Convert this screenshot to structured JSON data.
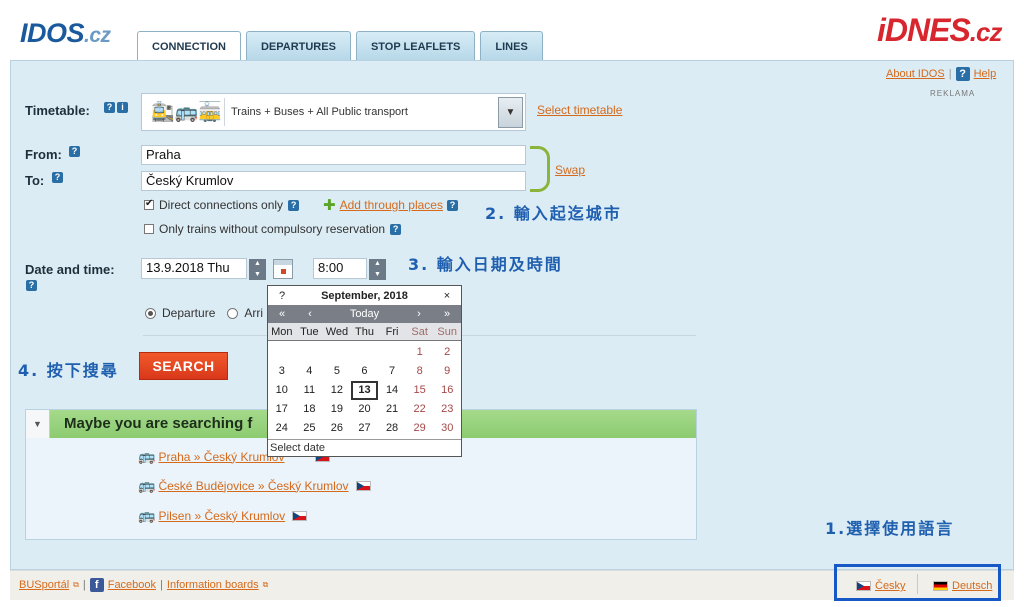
{
  "brand": {
    "idos_main": "IDOS",
    "idos_domain": ".cz",
    "idnes_main": "iDNES",
    "idnes_domain": ".cz"
  },
  "tabs": [
    {
      "label": "CONNECTION",
      "active": true
    },
    {
      "label": "DEPARTURES"
    },
    {
      "label": "STOP LEAFLETS"
    },
    {
      "label": "LINES"
    }
  ],
  "toplinks": {
    "about": "About IDOS",
    "help": "Help",
    "help_badge": "?"
  },
  "ad_label": "REKLAMA",
  "timetable": {
    "label": "Timetable:",
    "badge_q": "?",
    "badge_i": "i",
    "icons": "🚉🚌🚋",
    "value": "Trains + Buses + All Public transport",
    "select_link": "Select timetable",
    "dropdown_glyph": "▼"
  },
  "route": {
    "from_label": "From:",
    "to_label": "To:",
    "badge": "?",
    "from_value": "Praha",
    "to_value": "Český Krumlov",
    "swap_label": "Swap"
  },
  "options": {
    "direct_label": "Direct connections only",
    "direct_checked": true,
    "add_through": "Add through places",
    "plus_glyph": "✚",
    "trains_only_label": "Only trains without compulsory reservation",
    "trains_only_checked": false,
    "badge": "?"
  },
  "datetime": {
    "label": "Date and time:",
    "badge": "?",
    "date_value": "13.9.2018 Thu",
    "time_value": "8:00",
    "spin_up": "▲",
    "spin_down": "▼"
  },
  "direction": {
    "departure": "Departure",
    "arrival": "Arri"
  },
  "search_label": "SEARCH",
  "annotations": {
    "step1": "1.選擇使用語言",
    "step2": "2. 輸入起迄城市",
    "step3": "3. 輸入日期及時間",
    "step4": "4. 按下搜尋"
  },
  "suggestions": {
    "toggle_glyph": "▼",
    "title": "Maybe you are searching f",
    "bus_glyph": "🚌",
    "items": [
      {
        "label": "Praha » Český Krumlov"
      },
      {
        "label": "České Budějovice » Český Krumlov"
      },
      {
        "label": "Pilsen » Český Krumlov"
      }
    ]
  },
  "calendar": {
    "help": "?",
    "month": "September, 2018",
    "close": "×",
    "nav": {
      "prev_year": "«",
      "prev_month": "‹",
      "today": "Today",
      "next_month": "›",
      "next_year": "»"
    },
    "weekdays": [
      "Mon",
      "Tue",
      "Wed",
      "Thu",
      "Fri",
      "Sat",
      "Sun"
    ],
    "weeks": [
      [
        "",
        "",
        "",
        "",
        "",
        "1",
        "2"
      ],
      [
        "3",
        "4",
        "5",
        "6",
        "7",
        "8",
        "9"
      ],
      [
        "10",
        "11",
        "12",
        "13",
        "14",
        "15",
        "16"
      ],
      [
        "17",
        "18",
        "19",
        "20",
        "21",
        "22",
        "23"
      ],
      [
        "24",
        "25",
        "26",
        "27",
        "28",
        "29",
        "30"
      ]
    ],
    "today": "13",
    "footer": "Select date"
  },
  "footer": {
    "busportal": "BUSportál",
    "facebook": "Facebook",
    "fb_glyph": "f",
    "info_boards": "Information boards",
    "separator": "|",
    "ext_glyph": "⧉"
  },
  "languages": [
    {
      "label": "Česky",
      "flag": "cz"
    },
    {
      "label": "Deutsch",
      "flag": "de"
    }
  ],
  "colors": {
    "link": "#d56a1c",
    "accent_blue": "#1f5fb0",
    "search": "#e2431f",
    "suggest_header": "#96d07a"
  }
}
